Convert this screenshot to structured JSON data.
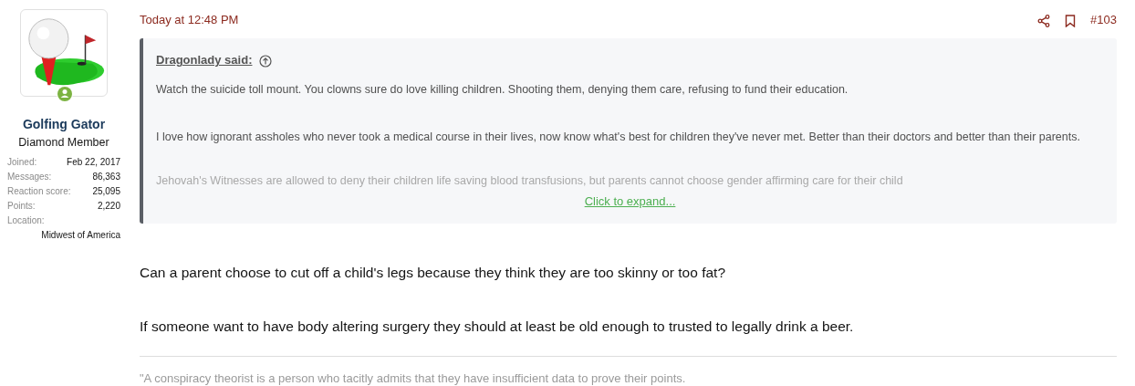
{
  "user": {
    "name": "Golfing Gator",
    "title": "Diamond Member",
    "online": true,
    "stats": [
      {
        "label": "Joined:",
        "value": "Feb 22, 2017"
      },
      {
        "label": "Messages:",
        "value": "86,363"
      },
      {
        "label": "Reaction score:",
        "value": "25,095"
      },
      {
        "label": "Points:",
        "value": "2,220"
      },
      {
        "label": "Location:",
        "value": "Midwest of America"
      }
    ]
  },
  "post": {
    "time": "Today at 12:48 PM",
    "number": "#103",
    "quote": {
      "author": "Dragonlady said:",
      "paragraphs": [
        "Watch the suicide toll mount. You clowns sure do love killing children. Shooting them, denying them care, refusing to fund their education.",
        "I love how ignorant assholes who never took a medical course in their lives, now know what's best for children they've never met. Better than their doctors and better than their parents.",
        "Jehovah's Witnesses are allowed to deny their children life saving blood transfusions, but parents cannot choose gender affirming care for their child"
      ],
      "expand": "Click to expand..."
    },
    "body": [
      "Can a parent choose to cut off a child's legs because they think they are too skinny or too fat?",
      "If someone want to have body altering surgery they should at least be old enough to trusted to legally drink a beer."
    ],
    "signature": "\"A conspiracy theorist is a person who tacitly admits that they have insufficient data to prove their points."
  }
}
